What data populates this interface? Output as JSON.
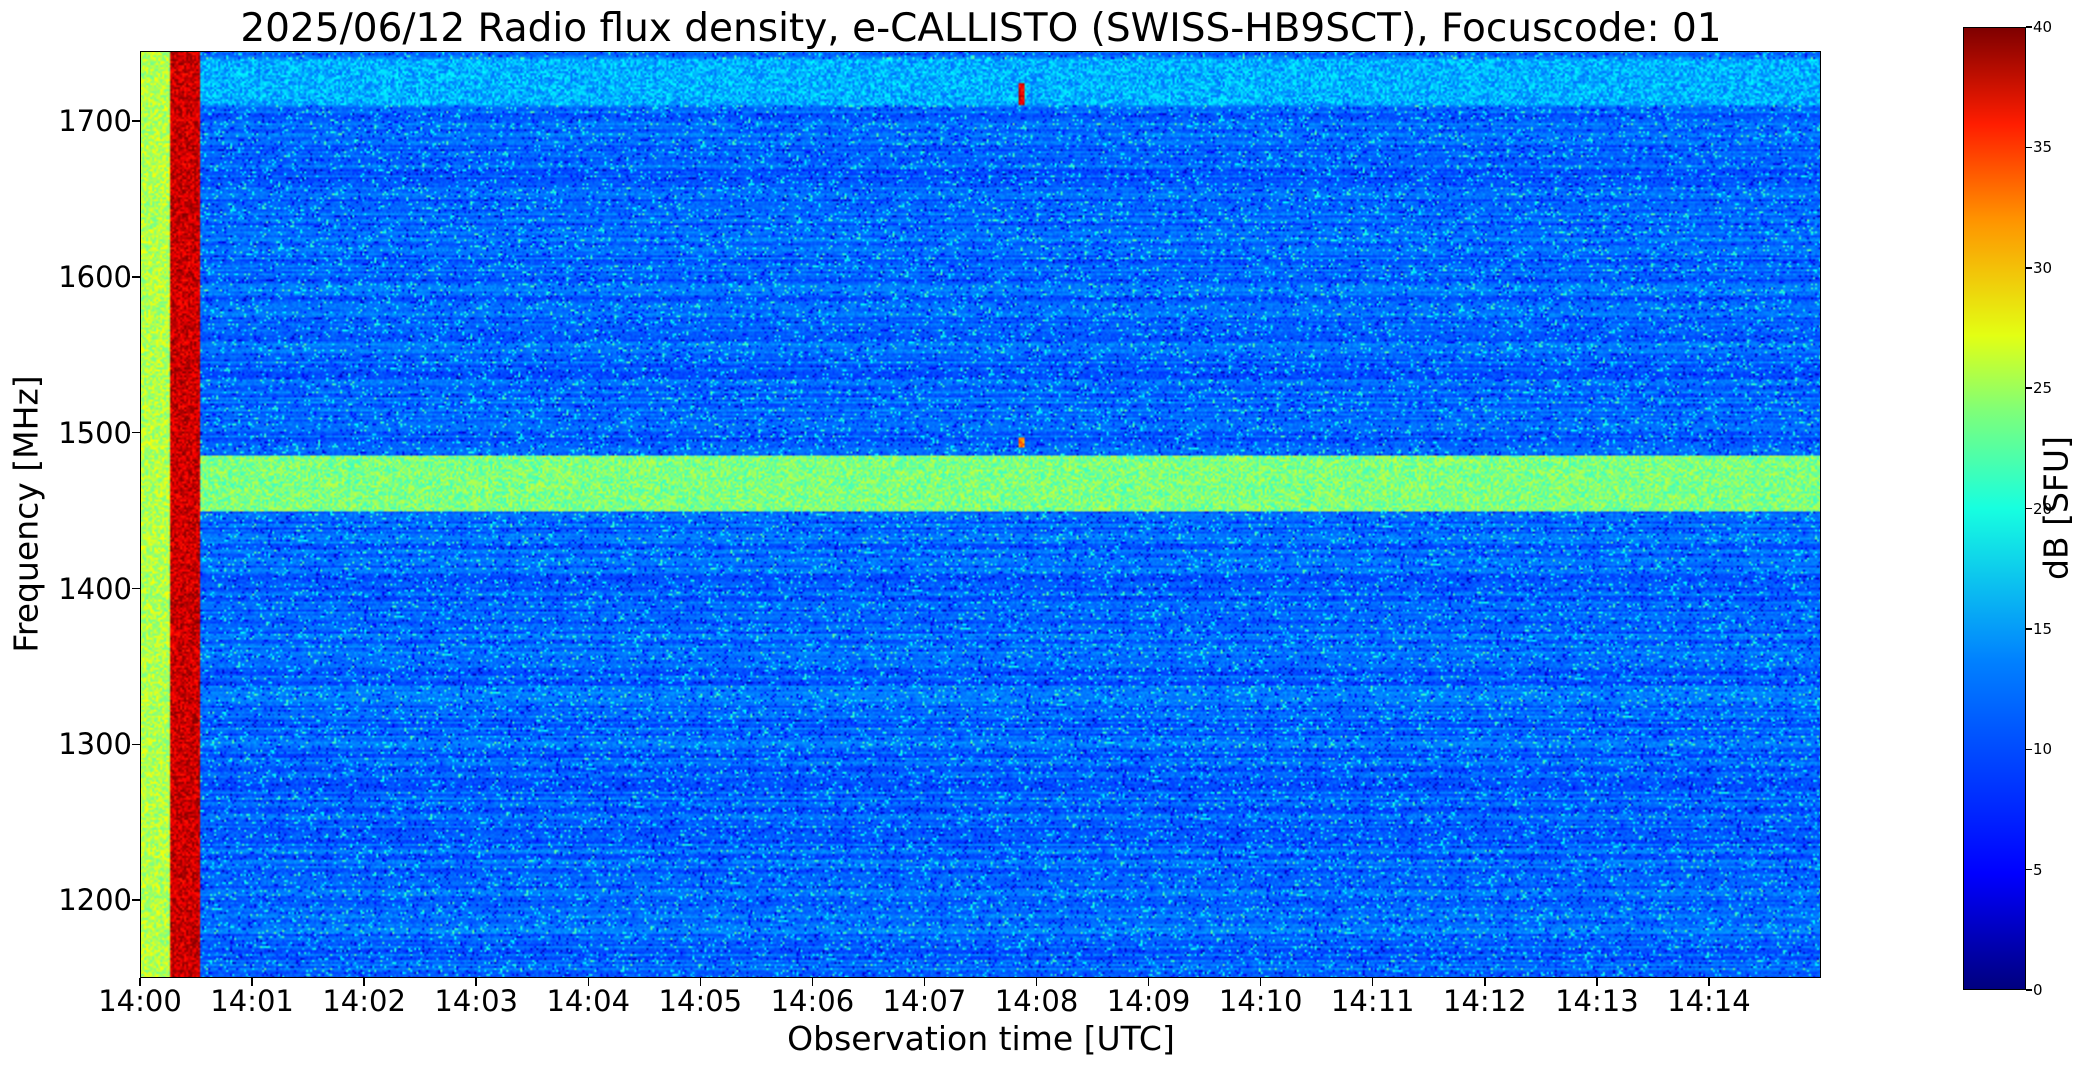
{
  "chart_data": {
    "type": "heatmap",
    "title": "2025/06/12  Radio flux density, e-CALLISTO (SWISS-HB9SCT), Focuscode: 01",
    "xlabel": "Observation time [UTC]",
    "ylabel": "Frequency [MHz]",
    "colorbar_label": "dB [SFU]",
    "colormap": "jet",
    "x_ticks": [
      "14:00",
      "14:01",
      "14:02",
      "14:03",
      "14:04",
      "14:05",
      "14:06",
      "14:07",
      "14:08",
      "14:09",
      "14:10",
      "14:11",
      "14:12",
      "14:13",
      "14:14"
    ],
    "x_range": [
      "14:00:00",
      "14:15:00"
    ],
    "y_ticks": [
      1200,
      1300,
      1400,
      1500,
      1600,
      1700
    ],
    "y_range": [
      1150,
      1745
    ],
    "colorbar_ticks": [
      0,
      5,
      10,
      15,
      20,
      25,
      30,
      35,
      40
    ],
    "colorbar_range": [
      0,
      40
    ],
    "background_level_dB": 9,
    "features": [
      {
        "description": "calibration interval",
        "time": [
          "14:00:00",
          "14:00:16"
        ],
        "freq_MHz": [
          1150,
          1745
        ],
        "level_dB": 22
      },
      {
        "description": "calibration interval",
        "time": [
          "14:00:16",
          "14:00:32"
        ],
        "freq_MHz": [
          1150,
          1745
        ],
        "level_dB": 37
      },
      {
        "description": "interference band",
        "time": [
          "14:00:32",
          "14:15:00"
        ],
        "freq_MHz": [
          1450,
          1485
        ],
        "level_dB": 20
      },
      {
        "description": "interference band",
        "time": [
          "14:00:32",
          "14:15:00"
        ],
        "freq_MHz": [
          1710,
          1740
        ],
        "level_dB": 12
      },
      {
        "description": "burst",
        "time": [
          "14:07:50",
          "14:07:54"
        ],
        "freq_MHz": [
          1710,
          1725
        ],
        "level_dB": 36
      },
      {
        "description": "burst",
        "time": [
          "14:07:50",
          "14:07:54"
        ],
        "freq_MHz": [
          1490,
          1497
        ],
        "level_dB": 30
      }
    ]
  }
}
